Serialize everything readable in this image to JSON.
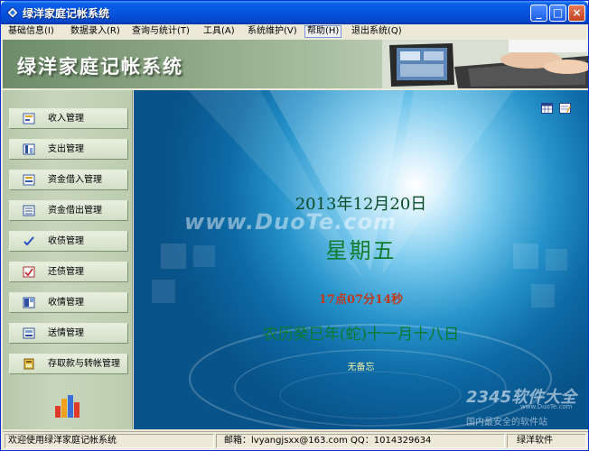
{
  "window": {
    "title": "绿洋家庭记帐系统"
  },
  "menu": {
    "items": [
      {
        "label": "基础信息(I)"
      },
      {
        "label": "数据录入(R)"
      },
      {
        "label": "查询与统计(T)"
      },
      {
        "label": "工具(A)"
      },
      {
        "label": "系统维护(V)"
      },
      {
        "label": "帮助(H)"
      },
      {
        "label": "退出系统(Q)"
      }
    ],
    "active_index": 5
  },
  "banner": {
    "app_name": "绿洋家庭记帐系统"
  },
  "sidebar": {
    "items": [
      {
        "label": "收入管理",
        "icon": "income-icon"
      },
      {
        "label": "支出管理",
        "icon": "expense-icon"
      },
      {
        "label": "资金借入管理",
        "icon": "borrow-in-icon"
      },
      {
        "label": "资金借出管理",
        "icon": "lend-out-icon"
      },
      {
        "label": "收债管理",
        "icon": "check-icon"
      },
      {
        "label": "还债管理",
        "icon": "repay-icon"
      },
      {
        "label": "收情管理",
        "icon": "gift-in-icon"
      },
      {
        "label": "送情管理",
        "icon": "gift-out-icon"
      },
      {
        "label": "存取款与转帐管理",
        "icon": "bank-icon"
      }
    ]
  },
  "main": {
    "watermark": "www.DuoTe.com",
    "date": "2013年12月20日",
    "weekday": "星期五",
    "time": "17点07分14秒",
    "lunar": "农历癸巳年(蛇)十一月十八日",
    "memo": "无备忘",
    "logo_2345": "2345软件大全",
    "logo_sub": "www.DuoTe.com",
    "logo_tagline": "国内最安全的软件站"
  },
  "status": {
    "welcome": "欢迎使用绿洋家庭记帐系统",
    "email": "邮箱：lvyangjsxx@163.com   QQ：1014329634",
    "brand": "绿洋软件"
  },
  "colors": {
    "titlebar": "#0854e0",
    "sidebar": "#c8d6bc",
    "date_text": "#0b4b2a",
    "time_text": "#c0391b"
  }
}
